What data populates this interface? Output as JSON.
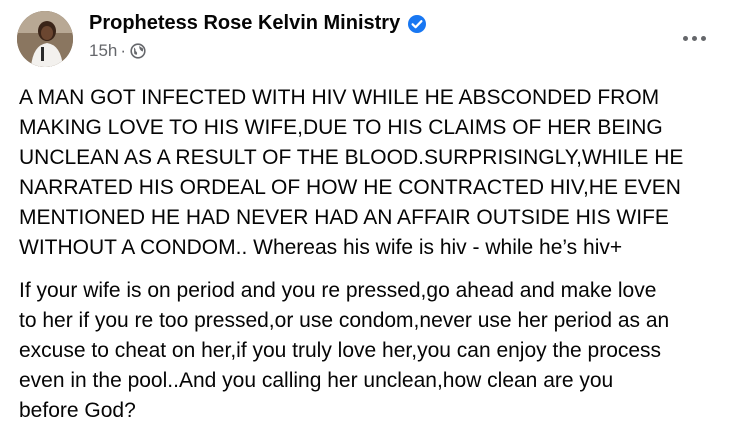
{
  "post": {
    "author": "Prophetess Rose Kelvin Ministry",
    "time": "15h",
    "separator": "·",
    "privacy_icon": "globe-icon",
    "verified_icon": "verified-badge-icon",
    "more_icon": "more-options-icon",
    "paragraphs": [
      "A MAN GOT INFECTED WITH HIV WHILE HE ABSCONDED FROM\nMAKING LOVE TO HIS WIFE,DUE TO HIS CLAIMS OF HER BEING\nUNCLEAN AS A RESULT OF THE BLOOD.SURPRISINGLY,WHILE HE\nNARRATED HIS ORDEAL OF HOW HE CONTRACTED HIV,HE EVEN\nMENTIONED HE HAD NEVER HAD AN AFFAIR OUTSIDE HIS WIFE\nWITHOUT A CONDOM.. Whereas his wife is hiv - while he’s hiv+",
      "If your wife is on period and you re pressed,go ahead and make love\nto her if you re too pressed,or use condom,never use her period as an\nexcuse to cheat on her,if you truly love her,you can enjoy the process\neven in the pool..And you calling her unclean,how clean are you\nbefore God?"
    ]
  },
  "colors": {
    "text": "#050505",
    "secondary": "#65676b",
    "verified": "#1877f2"
  }
}
